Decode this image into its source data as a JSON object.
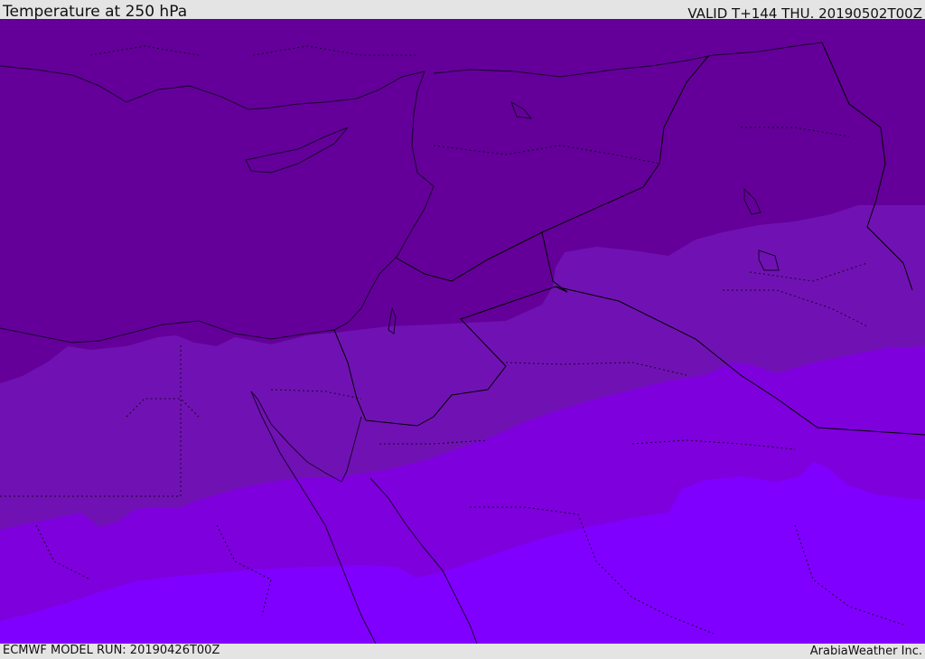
{
  "header": {
    "title": "Temperature at 250 hPa",
    "valid_time": "VALID T+144 THU. 20190502T00Z"
  },
  "footer": {
    "model_run": "ECMWF MODEL RUN: 20190426T00Z",
    "credit": "ArabiaWeather Inc."
  },
  "map": {
    "colors": {
      "band_1": "#640099",
      "band_2": "#7012b3",
      "band_3": "#7e00dc",
      "band_4": "#8000ff",
      "coastline": "#1a0030",
      "border": "#000000"
    }
  }
}
